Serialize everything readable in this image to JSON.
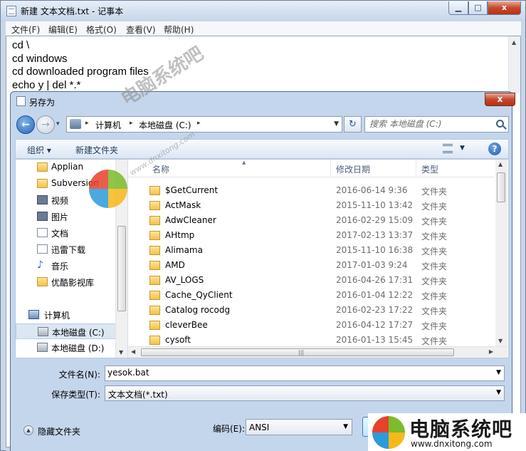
{
  "notepad": {
    "title": "新建 文本文档.txt - 记事本",
    "close_glyph": "x",
    "menu": [
      "文件(F)",
      "编辑(E)",
      "格式(O)",
      "查看(V)",
      "帮助(H)"
    ],
    "text": "cd \\\ncd windows\ncd downloaded program files\necho y | del *.*"
  },
  "dialog": {
    "title": "另存为",
    "close_glyph": "x",
    "address": {
      "segments": [
        "计算机",
        "本地磁盘 (C:)"
      ]
    },
    "search": {
      "placeholder": "搜索 本地磁盘 (C:)"
    },
    "toolbar": {
      "organize": "组织 ▾",
      "new_folder": "新建文件夹",
      "help_glyph": "?"
    },
    "nav_items": [
      {
        "label": "Applian",
        "icon": "folder-icon"
      },
      {
        "label": "Subversion",
        "icon": "folder-icon"
      },
      {
        "label": "视频",
        "icon": "video-library-icon"
      },
      {
        "label": "图片",
        "icon": "picture-library-icon"
      },
      {
        "label": "文档",
        "icon": "document-library-icon"
      },
      {
        "label": "迅雷下载",
        "icon": "download-library-icon"
      },
      {
        "label": "音乐",
        "icon": "music-library-icon"
      },
      {
        "label": "优酷影视库",
        "icon": "folder-icon"
      },
      {
        "label": "计算机",
        "icon": "computer-icon"
      },
      {
        "label": "本地磁盘 (C:)",
        "icon": "local-disk-icon",
        "selected": true
      },
      {
        "label": "本地磁盘 (D:)",
        "icon": "local-disk-icon"
      }
    ],
    "columns": [
      "名称",
      "修改日期",
      "类型"
    ],
    "files": [
      {
        "name": "$GetCurrent",
        "date": "2016-06-14 9:36",
        "type": "文件夹"
      },
      {
        "name": "ActMask",
        "date": "2015-11-10 13:42",
        "type": "文件夹"
      },
      {
        "name": "AdwCleaner",
        "date": "2016-02-29 15:09",
        "type": "文件夹"
      },
      {
        "name": "AHtmp",
        "date": "2017-02-13 13:37",
        "type": "文件夹"
      },
      {
        "name": "Alimama",
        "date": "2015-11-10 16:38",
        "type": "文件夹"
      },
      {
        "name": "AMD",
        "date": "2017-01-03 9:24",
        "type": "文件夹"
      },
      {
        "name": "AV_LOGS",
        "date": "2016-04-26 17:31",
        "type": "文件夹"
      },
      {
        "name": "Cache_QyClient",
        "date": "2016-01-04 12:22",
        "type": "文件夹"
      },
      {
        "name": "Catalog rocodg",
        "date": "2016-02-23 17:22",
        "type": "文件夹"
      },
      {
        "name": "cleverBee",
        "date": "2016-04-12 17:27",
        "type": "文件夹"
      },
      {
        "name": "cysoft",
        "date": "2016-01-13 15:45",
        "type": "文件夹"
      }
    ],
    "filename_label": "文件名(N):",
    "filename_value": "yesok.bat",
    "filetype_label": "保存类型(T):",
    "filetype_value": "文本文档(*.txt)",
    "hide_folders": "隐藏文件夹",
    "encoding_label": "编码(E):",
    "encoding_value": "ANSI"
  },
  "watermark": {
    "overlay_text": "电脑系统吧",
    "overlay_url": "www.dnxitong.com",
    "brand_name": "电脑系统吧",
    "brand_url": "www.dnxitong.com"
  },
  "colors": {
    "logo_red": "#e8412c",
    "logo_green": "#7cbb2a",
    "logo_blue": "#2b9bdc",
    "logo_yellow": "#f6b91a"
  }
}
